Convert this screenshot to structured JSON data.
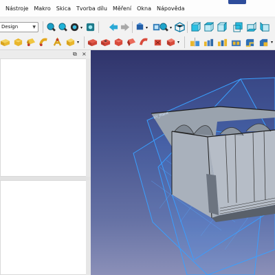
{
  "menubar": {
    "items": [
      "Nástroje",
      "Makro",
      "Skica",
      "Tvorba dílu",
      "Měření",
      "Okna",
      "Nápověda"
    ]
  },
  "toolbar": {
    "workbench_selected": "Design"
  },
  "combo_view": {
    "float_symbol": "⧉",
    "close_symbol": "×"
  },
  "viewport": {
    "plane_label": "XY_Plane"
  },
  "icons": {
    "toolbar1": [
      "zoom-icon",
      "zoom-all-icon",
      "draw-style-icon",
      "record-icon",
      "back-arrow-icon",
      "forward-arrow-icon",
      "sync-view-icon",
      "std-view-menu-icon",
      "measure-icon",
      "view-isometric-icon",
      "view-front-icon",
      "view-top-icon",
      "view-right-icon",
      "view-rear-icon",
      "view-bottom-icon",
      "view-left-icon"
    ],
    "toolbar2": [
      "pad-icon",
      "revolution-icon",
      "additive-loft-icon",
      "additive-pipe-icon",
      "additive-helix-icon",
      "additive-box-icon",
      "pocket-icon",
      "hole-icon",
      "groove-icon",
      "subtractive-loft-icon",
      "subtractive-pipe-icon",
      "subtractive-helix-icon",
      "subtractive-box-icon",
      "mirrored-icon",
      "linear-pattern-icon",
      "polar-pattern-icon",
      "multi-transform-icon",
      "fillet-icon",
      "chamfer-icon",
      "draft-icon",
      "thickness-icon"
    ]
  },
  "colors": {
    "accent_blue": "#1f9bd6",
    "plane_color": "#3aa0ff",
    "part_face": "#a9b1bc"
  }
}
